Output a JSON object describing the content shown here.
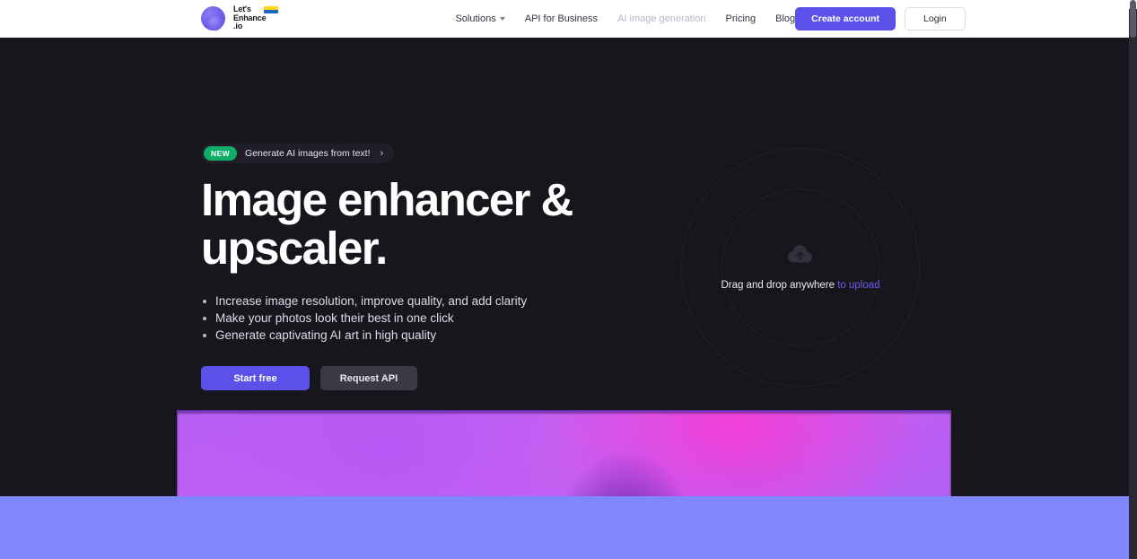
{
  "brand": {
    "logo_line1": "Let's",
    "logo_line2": "Enhance",
    "logo_line3": ".io",
    "logo_icon": "lets-enhance-blob-logo"
  },
  "header": {
    "nav": [
      {
        "label": "Solutions",
        "has_caret": true,
        "muted": false
      },
      {
        "label": "API for Business",
        "has_caret": false,
        "muted": false
      },
      {
        "label": "AI image generation",
        "has_caret": false,
        "muted": true
      },
      {
        "label": "Pricing",
        "has_caret": false,
        "muted": false
      },
      {
        "label": "Blog",
        "has_caret": false,
        "muted": false
      }
    ],
    "create_account_label": "Create account",
    "login_label": "Login"
  },
  "hero": {
    "badge_tag": "NEW",
    "badge_text": "Generate AI images from text!",
    "badge_chevron": "›",
    "title": "Image enhancer & upscaler.",
    "bullets": [
      "Increase image resolution, improve quality, and add clarity",
      "Make your photos look their best in one click",
      "Generate captivating AI art in high quality"
    ],
    "cta_primary": "Start free",
    "cta_secondary": "Request API"
  },
  "dropzone": {
    "icon": "cloud-upload-icon",
    "text_static": "Drag and drop anywhere ",
    "text_link": "to upload"
  },
  "colors": {
    "page_background": "#17161d",
    "header_background": "#ffffff",
    "accent_purple": "#5b51e8",
    "badge_green": "#0faf6a",
    "link_purple": "#6a5df0",
    "secondary_button": "#3b3946",
    "bottom_band": "#8087fb",
    "media_top_border": "#6b2fb0"
  }
}
